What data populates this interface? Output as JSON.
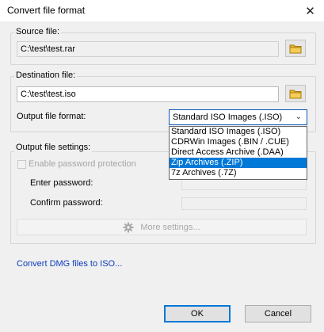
{
  "window": {
    "title": "Convert file format"
  },
  "source": {
    "label": "Source file:",
    "path": "C:\\test\\test.rar"
  },
  "destination": {
    "label": "Destination file:",
    "path": "C:\\test\\test.iso",
    "format_label": "Output file format:",
    "format_selected": "Standard ISO Images (.ISO)",
    "format_options": [
      "Standard ISO Images (.ISO)",
      "CDRWin Images (.BIN / .CUE)",
      "Direct Access Archive (.DAA)",
      "Zip Archives (.ZIP)",
      "7z Archives (.7Z)"
    ],
    "highlighted_option": "Zip Archives (.ZIP)"
  },
  "settings": {
    "label": "Output file settings:",
    "password_protection_label": "Enable password protection",
    "enter_password_label": "Enter password:",
    "confirm_password_label": "Confirm password:",
    "more_settings_label": "More settings..."
  },
  "link": {
    "convert_dmg": "Convert DMG files to ISO..."
  },
  "buttons": {
    "ok": "OK",
    "cancel": "Cancel"
  },
  "icons": {
    "close": "close-icon",
    "browse": "folder-icon",
    "dropdown": "chevron-down-icon",
    "settings": "gear-icon"
  },
  "colors": {
    "selection": "#0078d7",
    "link": "#0b3bbd",
    "folder": "#e8b830"
  }
}
